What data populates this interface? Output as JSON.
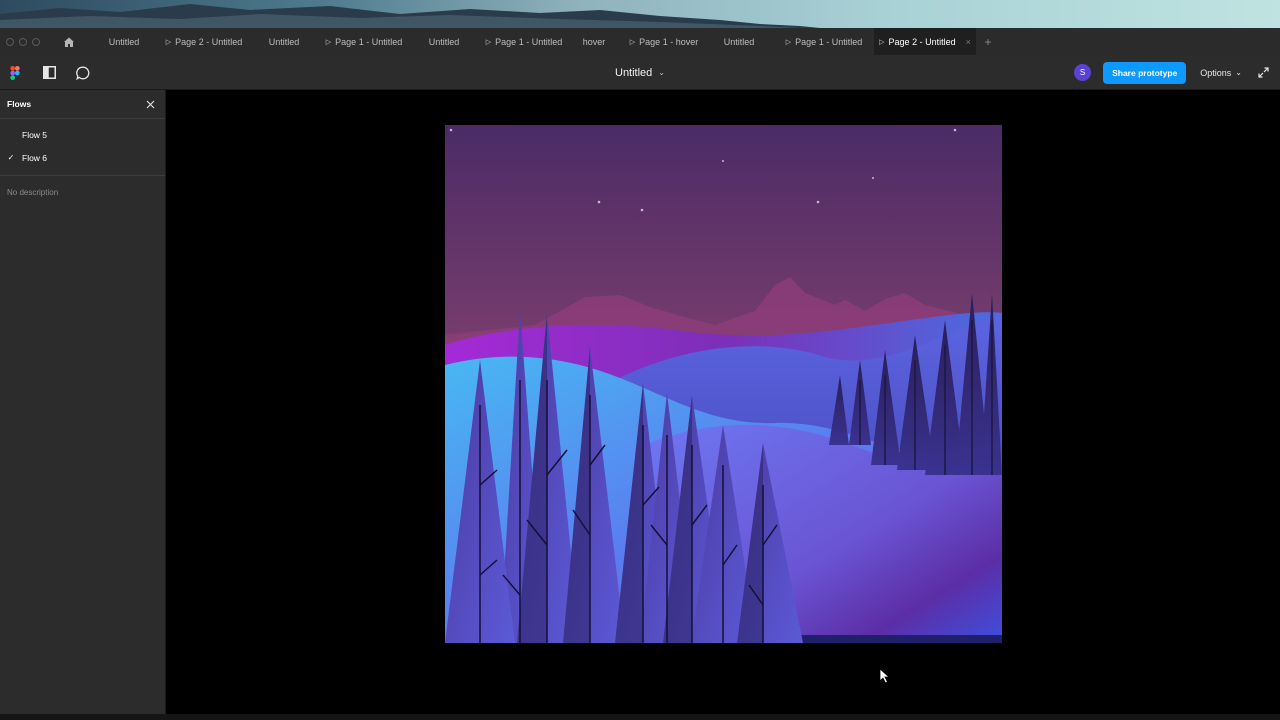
{
  "tabs": [
    {
      "label": "Untitled",
      "prototype": false,
      "active": false
    },
    {
      "label": "Page 2 - Untitled",
      "prototype": true,
      "active": false
    },
    {
      "label": "Untitled",
      "prototype": false,
      "active": false
    },
    {
      "label": "Page 1 - Untitled",
      "prototype": true,
      "active": false
    },
    {
      "label": "Untitled",
      "prototype": false,
      "active": false
    },
    {
      "label": "Page 1 - Untitled",
      "prototype": true,
      "active": false
    },
    {
      "label": "hover",
      "prototype": false,
      "active": false
    },
    {
      "label": "Page 1 - hover",
      "prototype": true,
      "active": false
    },
    {
      "label": "Untitled",
      "prototype": false,
      "active": false
    },
    {
      "label": "Page 1 - Untitled",
      "prototype": true,
      "active": false
    },
    {
      "label": "Page 2 - Untitled",
      "prototype": true,
      "active": true
    }
  ],
  "toolbar": {
    "file_title": "Untitled",
    "avatar_initial": "S",
    "share_label": "Share prototype",
    "options_label": "Options"
  },
  "sidebar": {
    "header": "Flows",
    "flows": [
      {
        "label": "Flow 5",
        "selected": false
      },
      {
        "label": "Flow 6",
        "selected": true
      }
    ],
    "description": "No description"
  },
  "colors": {
    "accent": "#0d99ff",
    "avatar": "#5b41d6",
    "panel": "#2c2c2c",
    "canvas": "#000000"
  },
  "icons": {
    "home": "home-icon",
    "app_logo": "figma-logo-icon",
    "panel_toggle": "panel-toggle-icon",
    "comment": "comment-icon",
    "close": "close-icon",
    "expand": "expand-icon"
  }
}
